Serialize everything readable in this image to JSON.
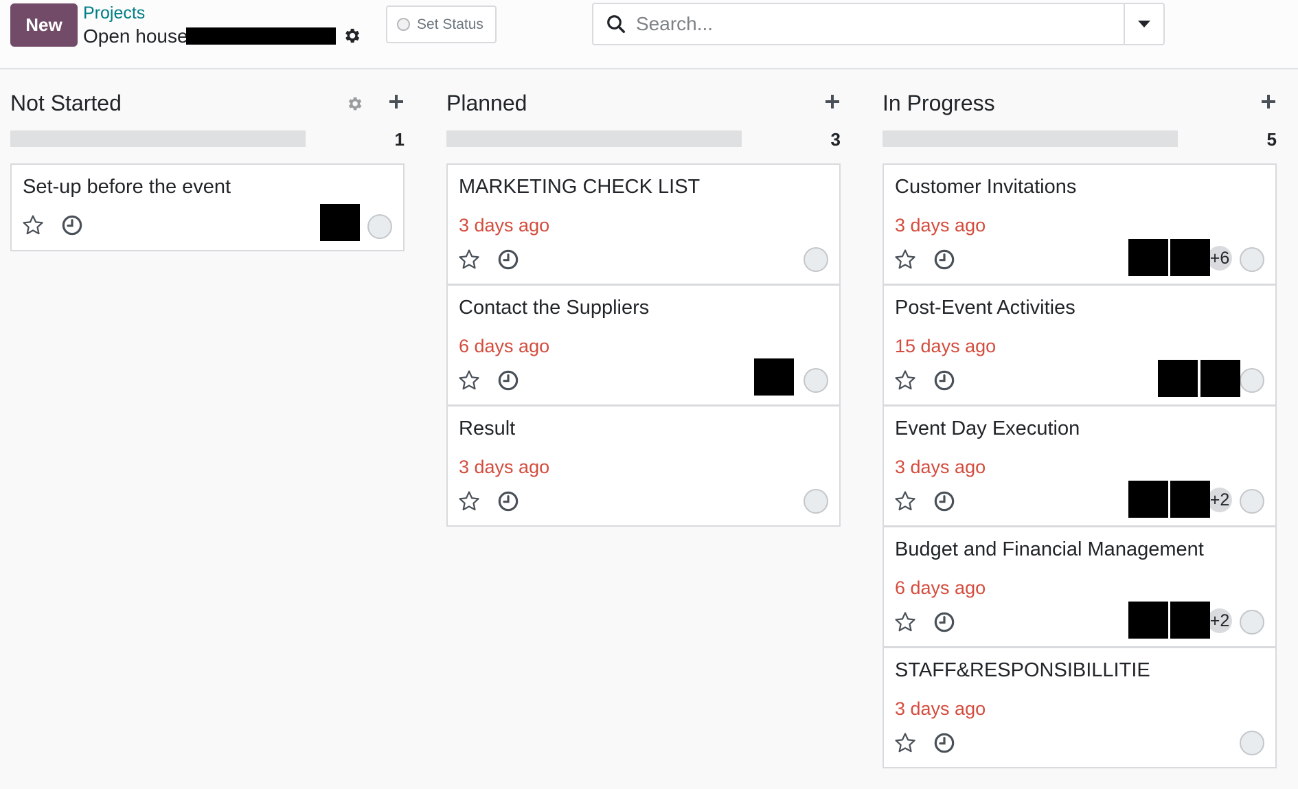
{
  "topbar": {
    "new_label": "New",
    "breadcrumb_parent": "Projects",
    "breadcrumb_current": "Open house",
    "set_status_label": "Set Status",
    "search_placeholder": "Search..."
  },
  "colors": {
    "brand": "#714b67",
    "link": "#017e84",
    "overdue": "#d44c3d"
  },
  "columns": [
    {
      "title": "Not Started",
      "count": "1",
      "cards": [
        {
          "title": "Set-up before the event",
          "date": "",
          "avatars": 1,
          "extra": ""
        }
      ]
    },
    {
      "title": "Planned",
      "count": "3",
      "cards": [
        {
          "title": "MARKETING CHECK LIST",
          "date": "3 days ago",
          "avatars": 0,
          "extra": ""
        },
        {
          "title": "Contact the Suppliers",
          "date": "6 days ago",
          "avatars": 1,
          "extra": ""
        },
        {
          "title": "Result",
          "date": "3 days ago",
          "avatars": 0,
          "extra": ""
        }
      ]
    },
    {
      "title": "In Progress",
      "count": "5",
      "cards": [
        {
          "title": "Customer Invitations",
          "date": "3 days ago",
          "avatars": 2,
          "extra": "+6"
        },
        {
          "title": "Post-Event Activities",
          "date": "15 days ago",
          "avatars": 2,
          "extra": ""
        },
        {
          "title": "Event Day Execution",
          "date": "3 days ago",
          "avatars": 2,
          "extra": "+2"
        },
        {
          "title": "Budget and Financial Management",
          "date": "6 days ago",
          "avatars": 2,
          "extra": "+2"
        },
        {
          "title": "STAFF&RESPONSIBILLITIE",
          "date": "3 days ago",
          "avatars": 0,
          "extra": ""
        }
      ]
    }
  ]
}
